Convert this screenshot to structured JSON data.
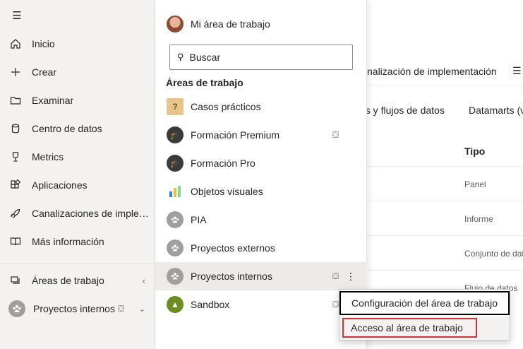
{
  "colors": {
    "nav_bg": "#f3f2f1",
    "selected_row": "#edebe9",
    "highlight_border": "#d13438",
    "focus_border": "#000000"
  },
  "leftnav": {
    "menu_icon": "hamburger-icon",
    "items": [
      {
        "label": "Inicio",
        "icon": "home-icon"
      },
      {
        "label": "Crear",
        "icon": "plus-icon"
      },
      {
        "label": "Examinar",
        "icon": "folder-icon"
      },
      {
        "label": "Centro de datos",
        "icon": "database-icon"
      },
      {
        "label": "Metrics",
        "icon": "trophy-icon"
      },
      {
        "label": "Aplicaciones",
        "icon": "apps-icon"
      },
      {
        "label": "Canalizaciones de implementación",
        "icon": "rocket-icon"
      },
      {
        "label": "Más información",
        "icon": "book-icon"
      }
    ],
    "workspaces_label": "Áreas de trabajo",
    "current_workspace_label": "Proyectos internos"
  },
  "background": {
    "toolbar_text": "nalización de implementación",
    "tabs": [
      "os y flujos de datos",
      "Datamarts (v"
    ],
    "column_header": "Tipo",
    "cells": [
      "Panel",
      "Informe",
      "Conjunto de dat",
      "Flujo de datos"
    ]
  },
  "flyout": {
    "my_workspace": "Mi área de trabajo",
    "search_placeholder": "Buscar",
    "heading": "Áreas de trabajo",
    "workspaces": [
      {
        "label": "Casos prácticos",
        "icon": "case-box-icon",
        "premium": false
      },
      {
        "label": "Formación Premium",
        "icon": "graduate-icon",
        "premium": true
      },
      {
        "label": "Formación Pro",
        "icon": "graduate-icon",
        "premium": false
      },
      {
        "label": "Objetos visuales",
        "icon": "bar-chart-icon",
        "premium": false
      },
      {
        "label": "PIA",
        "icon": "group-icon",
        "premium": false
      },
      {
        "label": "Proyectos externos",
        "icon": "group-icon",
        "premium": false
      },
      {
        "label": "Proyectos internos",
        "icon": "group-icon",
        "premium": true
      },
      {
        "label": "Sandbox",
        "icon": "sandbox-icon",
        "premium": true
      }
    ],
    "more_options": "⋮"
  },
  "context_menu": {
    "items": [
      {
        "label": "Configuración del área de trabajo"
      },
      {
        "label": "Acceso al área de trabajo"
      }
    ]
  }
}
